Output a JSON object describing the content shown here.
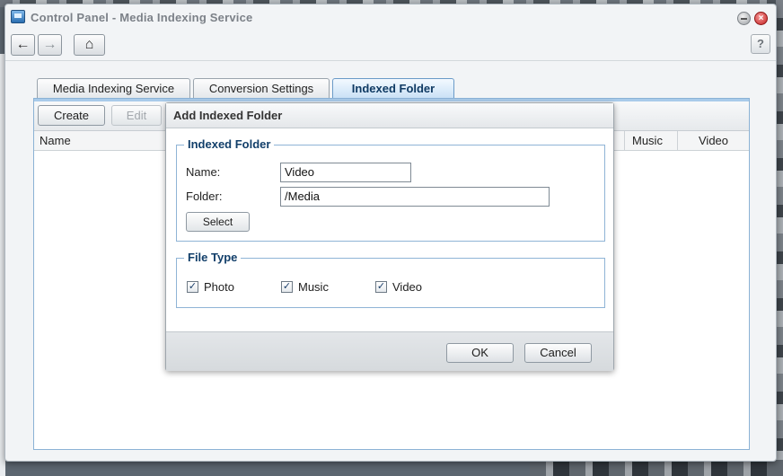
{
  "window": {
    "title": "Control Panel - Media Indexing Service",
    "close_glyph": "×",
    "help_label": "?"
  },
  "toolbar": {
    "back_icon": "←",
    "forward_icon": "→",
    "home_icon": "⌂"
  },
  "tabs": [
    {
      "label": "Media Indexing Service"
    },
    {
      "label": "Conversion Settings"
    },
    {
      "label": "Indexed Folder",
      "active": true
    }
  ],
  "panel": {
    "create_label": "Create",
    "edit_label": "Edit",
    "columns": [
      "Name",
      "Music",
      "Video"
    ]
  },
  "dialog": {
    "title": "Add Indexed Folder",
    "indexed_folder_legend": "Indexed Folder",
    "name_label": "Name:",
    "name_value": "Video",
    "folder_label": "Folder:",
    "folder_value": "/Media",
    "select_label": "Select",
    "file_type_legend": "File Type",
    "file_types": [
      {
        "label": "Photo",
        "checked": true
      },
      {
        "label": "Music",
        "checked": true
      },
      {
        "label": "Video",
        "checked": true
      }
    ],
    "check_glyph": "✓",
    "ok_label": "OK",
    "cancel_label": "Cancel"
  },
  "colors": {
    "accent_border": "#8fb4d6",
    "active_tab_text": "#0f3a63",
    "close_button": "#c42020"
  }
}
